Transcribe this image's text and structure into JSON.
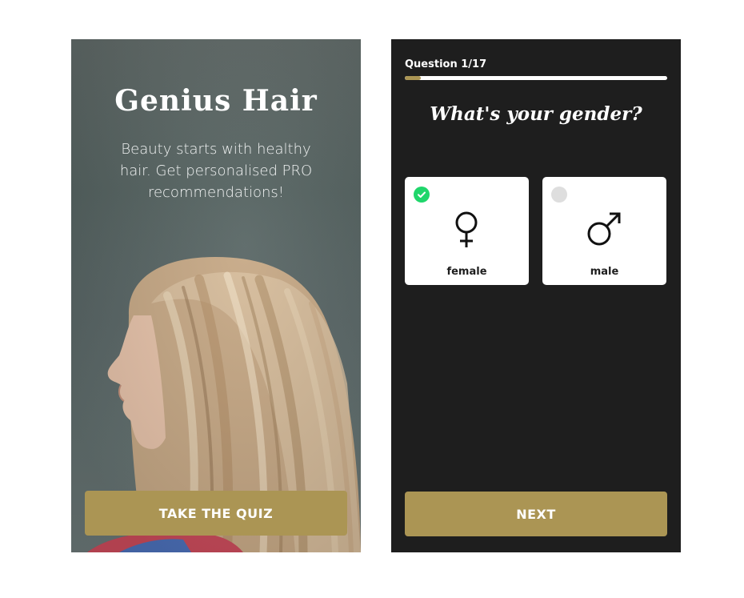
{
  "welcome": {
    "title": "Genius Hair",
    "tagline": "Beauty starts with healthy hair. Get personalised PRO recommendations!",
    "cta_label": "TAKE THE QUIZ"
  },
  "quiz": {
    "counter": "Question 1/17",
    "progress": 0.06,
    "question": "What's your gender?",
    "options": [
      {
        "label": "female",
        "icon": "female-symbol-icon",
        "selected": true
      },
      {
        "label": "male",
        "icon": "male-symbol-icon",
        "selected": false
      }
    ],
    "next_label": "NEXT"
  },
  "colors": {
    "accent": "#ab9554",
    "dark_bg": "#1e1e1e",
    "check_green": "#1fd66b"
  }
}
